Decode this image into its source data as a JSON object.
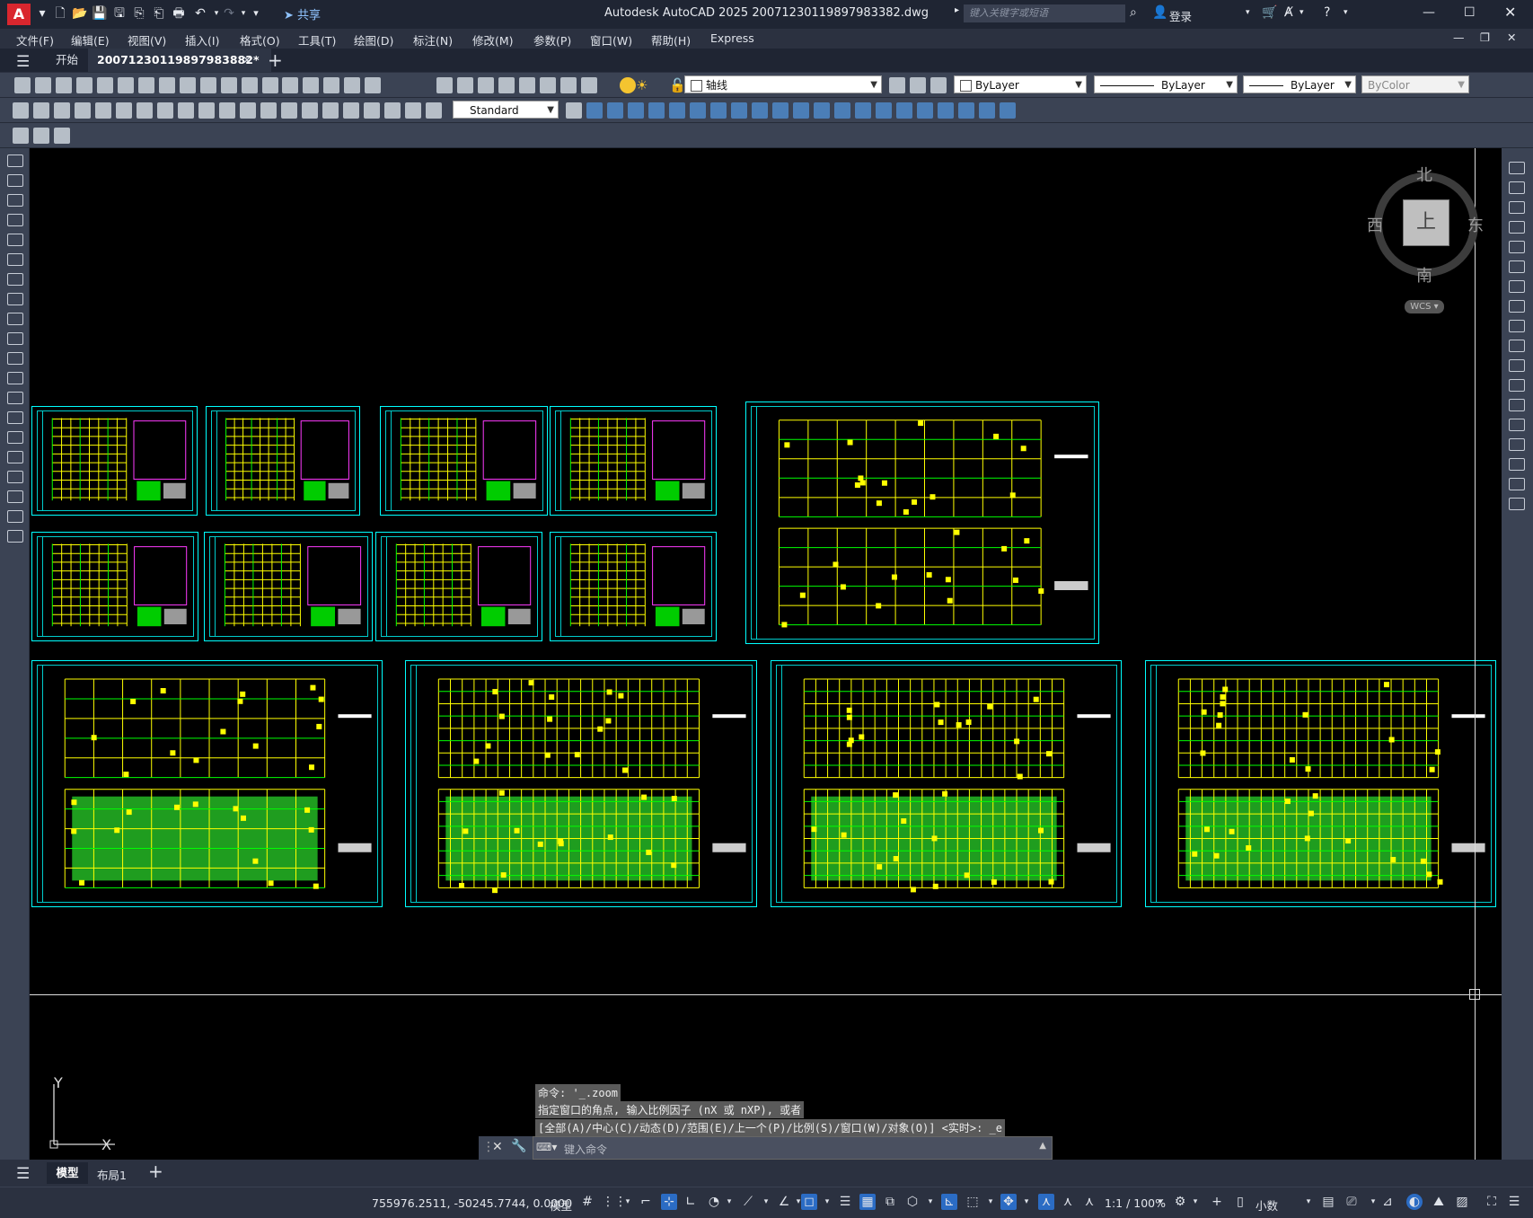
{
  "titlebar": {
    "app_logo": "A",
    "share_label": "共享",
    "title": "Autodesk AutoCAD 2025    20071230119897983382.dwg",
    "search_placeholder": "键入关键字或短语",
    "login_label": "登录"
  },
  "menu": [
    "文件(F)",
    "编辑(E)",
    "视图(V)",
    "插入(I)",
    "格式(O)",
    "工具(T)",
    "绘图(D)",
    "标注(N)",
    "修改(M)",
    "参数(P)",
    "窗口(W)",
    "帮助(H)",
    "Express"
  ],
  "tabs": {
    "start": "开始",
    "document": "20071230119897983882*"
  },
  "toolbar": {
    "layer_name": "轴线",
    "color": "ByLayer",
    "linetype": "ByLayer",
    "lineweight": "ByLayer",
    "plotstyle": "ByColor",
    "textstyle": "Standard"
  },
  "viewcube": {
    "north": "北",
    "south": "南",
    "east": "东",
    "west": "西",
    "face": "上",
    "wcs": "WCS"
  },
  "ucs": {
    "x": "X",
    "y": "Y"
  },
  "command": {
    "history": [
      "命令: '_.zoom",
      "指定窗口的角点, 输入比例因子 (nX 或 nXP), 或者",
      "[全部(A)/中心(C)/动态(D)/范围(E)/上一个(P)/比例(S)/窗口(W)/对象(O)] <实时>: _e"
    ],
    "placeholder": "键入命令"
  },
  "layouts": {
    "model": "模型",
    "layout1": "布局1"
  },
  "status": {
    "coordinates": "755976.2511, -50245.7744, 0.0000",
    "model_label": "模型",
    "scale": "1:1 / 100%",
    "units": "小数"
  },
  "colors": {
    "canvas": "#000000",
    "frame": "#00ffff",
    "drawing_yellow": "#ffff00",
    "drawing_green": "#00ff00",
    "accent": "#2b6cc4"
  }
}
